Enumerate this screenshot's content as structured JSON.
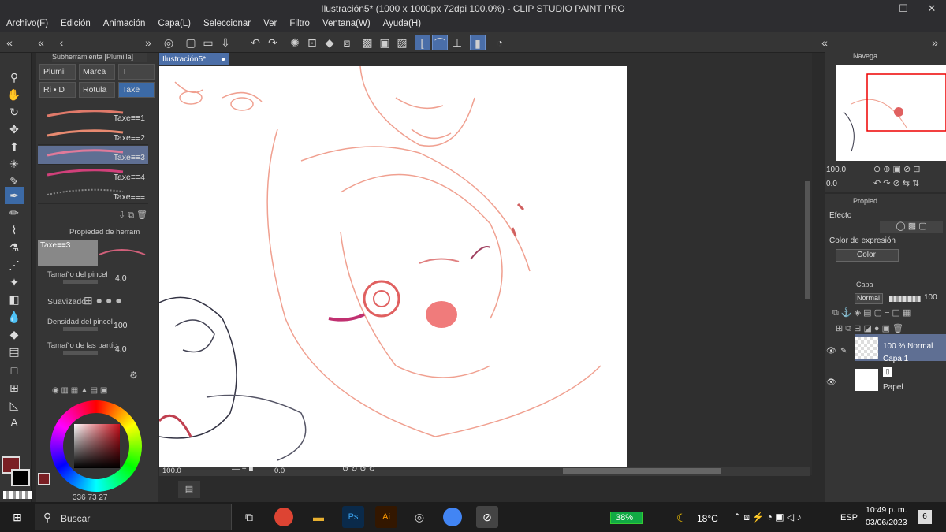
{
  "window": {
    "title": "Ilustración5* (1000 x 1000px 72dpi 100.0%)  - CLIP STUDIO PAINT PRO",
    "minimize": "—",
    "maximize": "☐",
    "close": "✕"
  },
  "menu": [
    "Archivo(F)",
    "Edición",
    "Animación",
    "Capa(L)",
    "Seleccionar",
    "Ver",
    "Filtro",
    "Ventana(W)",
    "Ayuda(H)"
  ],
  "subtool": {
    "header": "Subherramienta [Plumilla]",
    "groups": [
      "Plumil",
      "Marca",
      "T",
      "Ri • D",
      "Rotula",
      "Taxe"
    ],
    "brushes": [
      "Taxe≡≡1",
      "Taxe≡≡2",
      "Taxe≡≡3",
      "Taxe≡≡4",
      "Taxe≡≡≡"
    ]
  },
  "tool_property": {
    "header": "Propiedad de herram",
    "preset": "Taxe≡≡3",
    "brush_size_label": "Tamaño del pincel",
    "brush_size": "4.0",
    "smoothing_label": "Suavizado",
    "density_label": "Densidad del pincel",
    "density": "100",
    "particle_size_label": "Tamaño de las partíc",
    "particle_size": "4.0"
  },
  "color": {
    "main": "#7a1f24",
    "sub": "#000000",
    "values": [
      "336",
      "73",
      "27"
    ]
  },
  "document_tab": "Ilustración5*",
  "canvas_status": {
    "zoom": "100.0",
    "angle": "0.0"
  },
  "navigator": {
    "tab": "Navega",
    "zoom": "100.0",
    "angle": "0.0"
  },
  "property_panel": {
    "tab": "Propied",
    "effect_label": "Efecto",
    "expression_label": "Color de expresión",
    "expression_value": "Color"
  },
  "layers": {
    "tab": "Capa",
    "blend_mode": "Normal",
    "opacity": "100",
    "items": [
      {
        "title": "100 % Normal",
        "name": "Capa 1"
      },
      {
        "title": "",
        "name": "Papel"
      }
    ]
  },
  "taskbar": {
    "search_placeholder": "Buscar",
    "battery": "38%",
    "temperature": "18°C",
    "language": "ESP",
    "time": "10:49 p. m.",
    "date": "03/06/2023",
    "notifications": "6"
  }
}
